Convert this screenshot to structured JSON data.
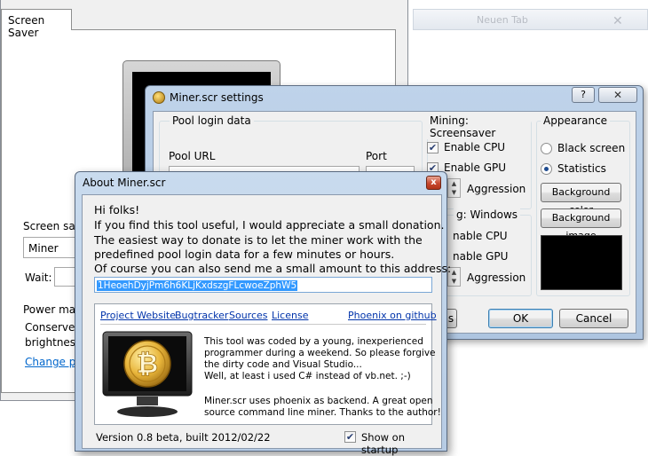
{
  "background_browser": {
    "tab_text": "Neuen Tab",
    "faint_text": ""
  },
  "screen_saver_window": {
    "tab_label": "Screen Saver",
    "screensaver_group_label": "Screen save",
    "screensaver_selected": "Miner",
    "wait_label": "Wait:",
    "power_group_label": "Power man",
    "power_text_line1": "Conserve e",
    "power_text_line2": "brightness",
    "power_link": "Change po"
  },
  "miner_settings": {
    "title": "Miner.scr settings",
    "help_label": "?",
    "close_label": "✕",
    "pool_group": {
      "title": "Pool login data",
      "pool_url_label": "Pool URL",
      "port_label": "Port"
    },
    "mining_screensaver": {
      "title": "Mining: Screensaver",
      "enable_cpu": "Enable CPU",
      "enable_gpu": "Enable GPU",
      "aggression": "Aggression",
      "cpu_checked": true,
      "gpu_checked": true
    },
    "mining_windows": {
      "title": "Mining: Windows",
      "title_visible": "g: Windows",
      "enable_cpu": "Enable CPU",
      "enable_cpu_visible": "nable CPU",
      "enable_gpu_visible": "nable GPU",
      "aggression": "Aggression"
    },
    "appearance": {
      "title": "Appearance",
      "black_screen": "Black screen",
      "statistics": "Statistics",
      "selected": "Statistics",
      "background_color_button": "Background color",
      "background_image_button": "Background image"
    },
    "ok_button": "OK",
    "cancel_button": "Cancel",
    "partial_button": "s"
  },
  "about_dialog": {
    "title": "About Miner.scr",
    "close_label": "x",
    "lines": [
      "Hi folks!",
      "If you find this tool useful, I would appreciate a small donation.",
      "The easiest way to donate is to let the miner work with the",
      "predefined pool login data for a few minutes or hours.",
      "Of course you can also send me a small amount to this address:"
    ],
    "address": "1HeoehDyjPm6h6KLjKxdszgFLcwoeZphW5",
    "links": {
      "project_website": "Project Website",
      "bugtracker": "Bugtracker",
      "sources": "Sources",
      "license": "License",
      "phoenix": "Phoenix on github"
    },
    "description": [
      "This tool was coded by a young, inexperienced",
      "programmer during a weekend. So please forgive",
      "the dirty code and Visual Studio...",
      "Well, at least i used C# instead of vb.net. ;-)",
      "",
      "Miner.scr uses phoenix as backend. A great open",
      "source command line miner. Thanks to the author!"
    ],
    "version": "Version 0.8 beta, built 2012/02/22",
    "show_on_startup": "Show on startup",
    "show_on_startup_checked": true
  }
}
